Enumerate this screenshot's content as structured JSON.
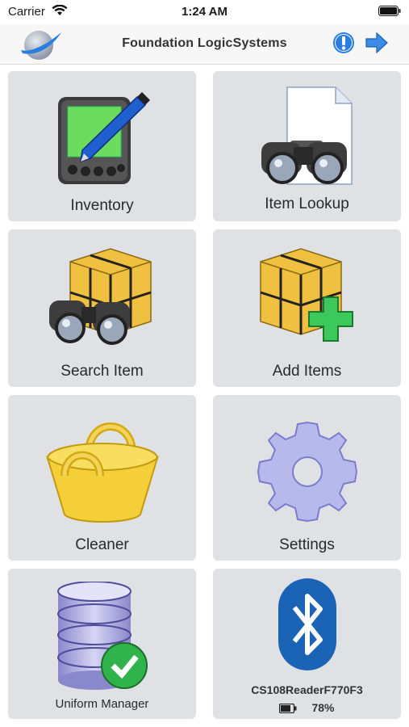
{
  "status_bar": {
    "carrier": "Carrier",
    "time": "1:24 AM"
  },
  "nav": {
    "title": "Foundation LogicSystems",
    "icons": [
      "app-logo-icon",
      "info-icon",
      "forward-arrow-icon"
    ]
  },
  "tiles": [
    {
      "label": "Inventory",
      "icon": "handheld-pen-icon"
    },
    {
      "label": "Item Lookup",
      "icon": "binoculars-document-icon"
    },
    {
      "label": "Search Item",
      "icon": "boxes-binoculars-icon"
    },
    {
      "label": "Add Items",
      "icon": "boxes-plus-icon"
    },
    {
      "label": "Cleaner",
      "icon": "basket-icon"
    },
    {
      "label": "Settings",
      "icon": "gear-icon"
    },
    {
      "label": "Uniform Manager",
      "icon": "database-check-icon"
    },
    {
      "label": "CS108ReaderF770F3",
      "icon": "bluetooth-icon",
      "battery": "78%"
    }
  ],
  "colors": {
    "tile_bg": "#dfe1e4",
    "accent_blue": "#2a7de1",
    "bluetooth_blue": "#1a63b5",
    "check_green": "#2fb34a"
  }
}
